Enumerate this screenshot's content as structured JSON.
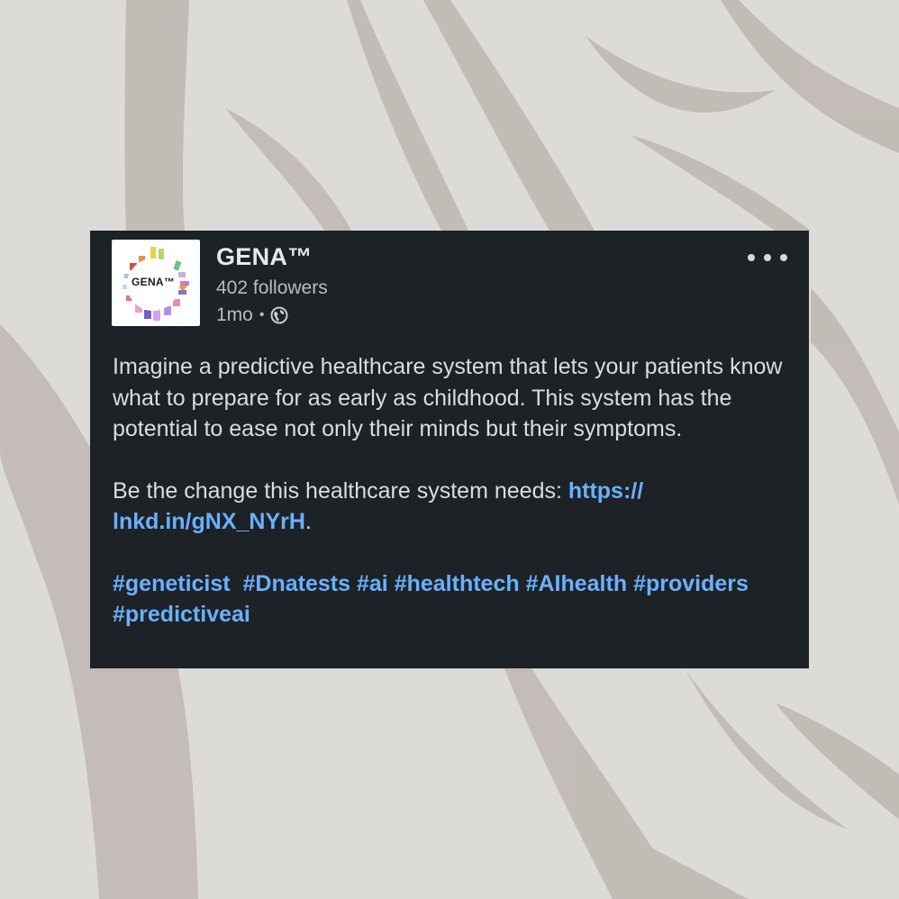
{
  "post": {
    "author_name": "GENA™",
    "followers": "402 followers",
    "time": "1mo",
    "dot": "•",
    "visibility_icon": "globe-icon",
    "avatar_logo_text": "GENA™",
    "more_icon": "more-horizontal-icon",
    "paragraph1": "Imagine a predictive healthcare system that lets your patients know what to prepare for as early as childhood. This system has the potential to ease not only their minds but their symptoms.",
    "paragraph2_prefix": "Be the change this healthcare system needs: ",
    "link_text": "https:// lnkd.in/gNX_NYrH",
    "link_suffix": ".",
    "hashtags": [
      "#geneticist",
      "#Dnatests",
      "#ai",
      "#healthtech",
      "#AIhealth",
      "#providers",
      "#predictiveai"
    ]
  },
  "colors": {
    "card_background": "#1d2226",
    "link": "#6ab0ff",
    "text": "#dcdcdc",
    "muted": "#b9bcbf",
    "page_background": "#dcdad7"
  }
}
